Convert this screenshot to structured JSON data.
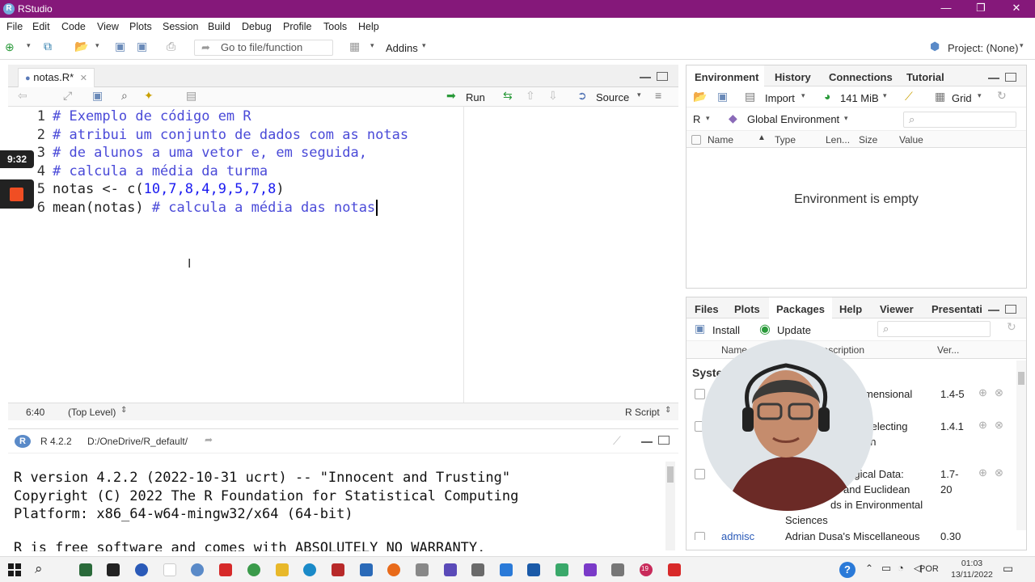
{
  "window": {
    "title": "RStudio"
  },
  "menu": [
    "File",
    "Edit",
    "Code",
    "View",
    "Plots",
    "Session",
    "Build",
    "Debug",
    "Profile",
    "Tools",
    "Help"
  ],
  "toolbar": {
    "goto_placeholder": "Go to file/function",
    "addins": "Addins",
    "project": "Project: (None)"
  },
  "editor": {
    "tab_label": "notas.R*",
    "run_label": "Run",
    "source_label": "Source",
    "lines": [
      {
        "n": "1",
        "text": "# Exemplo de código em R"
      },
      {
        "n": "2",
        "text": "# atribui um conjunto de dados com as notas"
      },
      {
        "n": "3",
        "text": "# de alunos a uma vetor e, em seguida,"
      },
      {
        "n": "4",
        "text": "# calcula a média da turma"
      },
      {
        "n": "5",
        "text": "notas <- c(10,7,8,4,9,5,7,8)"
      },
      {
        "n": "6",
        "text": "mean(notas) # calcula a média das notas"
      }
    ],
    "status_pos": "6:40",
    "status_scope": "(Top Level)",
    "status_type": "R Script"
  },
  "overlay": {
    "timer": "9:32"
  },
  "console": {
    "header": "R 4.2.2 · D:/OneDrive/R_default/",
    "version": "R 4.2.2",
    "path": "D:/OneDrive/R_default/",
    "lines": [
      "R version 4.2.2 (2022-10-31 ucrt) -- \"Innocent and Trusting\"",
      "Copyright (C) 2022 The R Foundation for Statistical Computing",
      "Platform: x86_64-w64-mingw32/x64 (64-bit)",
      "R is free software and comes with ABSOLUTELY NO WARRANTY."
    ]
  },
  "env_pane": {
    "tabs": [
      "Environment",
      "History",
      "Connections",
      "Tutorial"
    ],
    "import": "Import",
    "memory": "141 MiB",
    "grid": "Grid",
    "lang": "R",
    "scope": "Global Environment",
    "columns": [
      "Name",
      "Type",
      "Len...",
      "Size",
      "Value"
    ],
    "empty_msg": "Environment is empty"
  },
  "files_pane": {
    "tabs": [
      "Files",
      "Plots",
      "Packages",
      "Help",
      "Viewer",
      "Presentati"
    ],
    "install": "Install",
    "update": "Update",
    "columns": [
      "Name",
      "Description",
      "Ver..."
    ],
    "section": "Syste",
    "rows": [
      {
        "desc": "mensional",
        "ver": "1.4-5"
      },
      {
        "desc": "Selecting",
        "desc2": "on",
        "ver": "1.4.1"
      },
      {
        "desc": "ological Data:",
        "desc2": "and Euclidean",
        "desc3": "ds in Environmental",
        "desc4": "Sciences",
        "ver": "1.7-",
        "ver2": "20"
      },
      {
        "name": "admisc",
        "desc": "Adrian Dusa's Miscellaneous",
        "ver": "0.30"
      }
    ]
  },
  "taskbar": {
    "lang": "POR",
    "time": "01:03",
    "date": "13/11/2022",
    "badge": "19"
  },
  "colors": {
    "titlebar": "#85187a",
    "comment": "#4a4ad8",
    "number": "#1a1af0"
  }
}
